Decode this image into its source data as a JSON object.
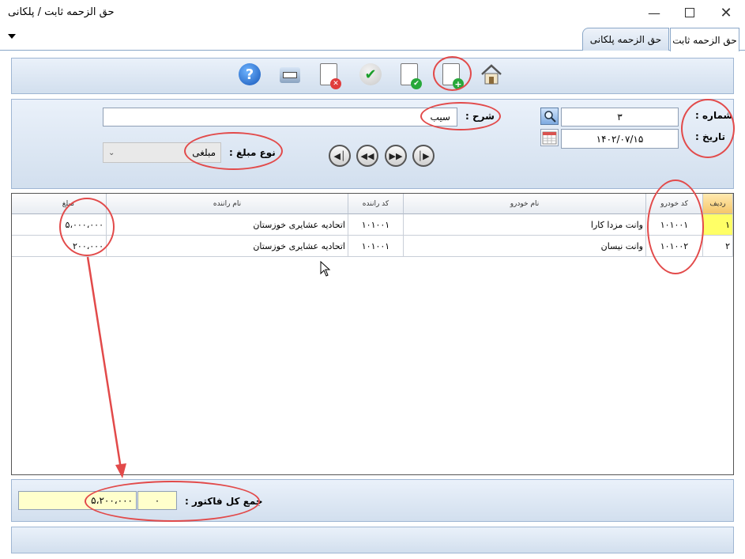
{
  "window": {
    "title": "حق الزحمه ثابت / پلکانی"
  },
  "tabs": [
    {
      "label": "حق الزحمه ثابت"
    },
    {
      "label": "حق الزحمه پلکانی"
    }
  ],
  "form": {
    "number_label": "شماره :",
    "number_value": "۳",
    "date_label": "تاریخ :",
    "date_value": "۱۴۰۲/۰۷/۱۵",
    "desc_label": "شرح :",
    "desc_value": "سیب",
    "amount_type_label": "نوع مبلغ :",
    "amount_type_value": "مبلغی"
  },
  "grid": {
    "headers": [
      "ردیف",
      "کد خودرو",
      "نام خودرو",
      "کد راننده",
      "نام راننده",
      "مبلغ"
    ],
    "rows": [
      {
        "row": "۱",
        "car_code": "۱۰۱۰۰۱",
        "car_name": "وانت مزدا کارا",
        "driver_code": "۱۰۱۰۰۱",
        "driver_name": "اتحادیه عشایری خوزستان",
        "amount": "۵،۰۰۰،۰۰۰"
      },
      {
        "row": "۲",
        "car_code": "۱۰۱۰۰۲",
        "car_name": "وانت نیسان",
        "driver_code": "۱۰۱۰۰۱",
        "driver_name": "اتحادیه عشایری خوزستان",
        "amount": "۲۰۰،۰۰۰"
      }
    ]
  },
  "footer": {
    "total_label": "جمع کل فاکتور :",
    "total_count": "۰",
    "total_value": "۵،۲۰۰،۰۰۰"
  },
  "colors": {
    "highlight_row": "#ffff66",
    "annotation": "#e24a4a",
    "panel": "#dbe6f3",
    "total_field": "#ffffcc"
  }
}
